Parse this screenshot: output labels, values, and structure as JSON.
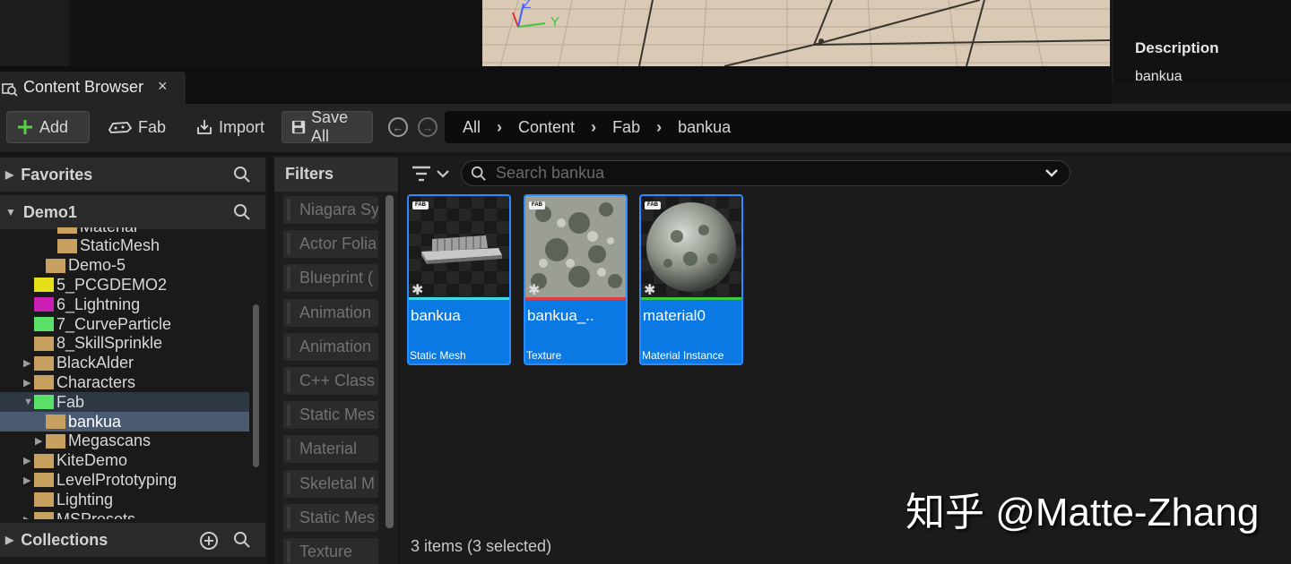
{
  "viewport": {
    "axis_y": "Y",
    "axis_z": "Z"
  },
  "details": {
    "title": "Description",
    "value": "bankua"
  },
  "tab": {
    "label": "Content Browser",
    "close": "×"
  },
  "toolbar": {
    "add_label": "Add",
    "fab_label": "Fab",
    "import_label": "Import",
    "save_all_label": "Save All"
  },
  "breadcrumb": [
    "All",
    "Content",
    "Fab",
    "bankua"
  ],
  "sidebar": {
    "favorites": "Favorites",
    "project": "Demo1",
    "collections": "Collections",
    "tree": [
      {
        "label": "Material",
        "indent": 2,
        "arrow": "",
        "color": "#c8a060"
      },
      {
        "label": "StaticMesh",
        "indent": 2,
        "arrow": "",
        "color": "#c8a060"
      },
      {
        "label": "Demo-5",
        "indent": 1,
        "arrow": "",
        "color": "#c8a060"
      },
      {
        "label": "5_PCGDEMO2",
        "indent": 0,
        "arrow": "",
        "color": "#e6e01a"
      },
      {
        "label": "6_Lightning",
        "indent": 0,
        "arrow": "",
        "color": "#c81eb4"
      },
      {
        "label": "7_CurveParticle",
        "indent": 0,
        "arrow": "",
        "color": "#5be06a"
      },
      {
        "label": "8_SkillSprinkle",
        "indent": 0,
        "arrow": "",
        "color": "#c8a060"
      },
      {
        "label": "BlackAlder",
        "indent": 0,
        "arrow": "▶",
        "color": "#c8a060"
      },
      {
        "label": "Characters",
        "indent": 0,
        "arrow": "▶",
        "color": "#c8a060"
      },
      {
        "label": "Fab",
        "indent": 0,
        "arrow": "▼",
        "color": "#5be06a"
      },
      {
        "label": "bankua",
        "indent": 1,
        "arrow": "",
        "color": "#c8a060"
      },
      {
        "label": "Megascans",
        "indent": 1,
        "arrow": "▶",
        "color": "#c8a060"
      },
      {
        "label": "KiteDemo",
        "indent": 0,
        "arrow": "▶",
        "color": "#c8a060"
      },
      {
        "label": "LevelPrototyping",
        "indent": 0,
        "arrow": "▶",
        "color": "#c8a060"
      },
      {
        "label": "Lighting",
        "indent": 0,
        "arrow": "",
        "color": "#c8a060"
      },
      {
        "label": "MSPresets",
        "indent": 0,
        "arrow": "▶",
        "color": "#c8a060"
      }
    ]
  },
  "filters": {
    "title": "Filters",
    "items": [
      "Niagara Sy",
      "Actor Folia",
      "Blueprint (",
      "Animation",
      "Animation",
      "C++ Class",
      "Static Mes",
      "Material",
      "Skeletal M",
      "Static Mes",
      "Texture"
    ]
  },
  "search": {
    "placeholder": "Search bankua"
  },
  "assets": [
    {
      "name": "bankua",
      "type": "Static Mesh",
      "bar_color": "#3ad8e8",
      "badge": "FAB"
    },
    {
      "name": "bankua_..",
      "type": "Texture",
      "bar_color": "#e04040",
      "badge": "FAB"
    },
    {
      "name": "material0",
      "type": "Material Instance",
      "bar_color": "#3cc83c",
      "badge": "FAB"
    }
  ],
  "status": "3 items (3 selected)",
  "watermark": "知乎 @Matte-Zhang"
}
